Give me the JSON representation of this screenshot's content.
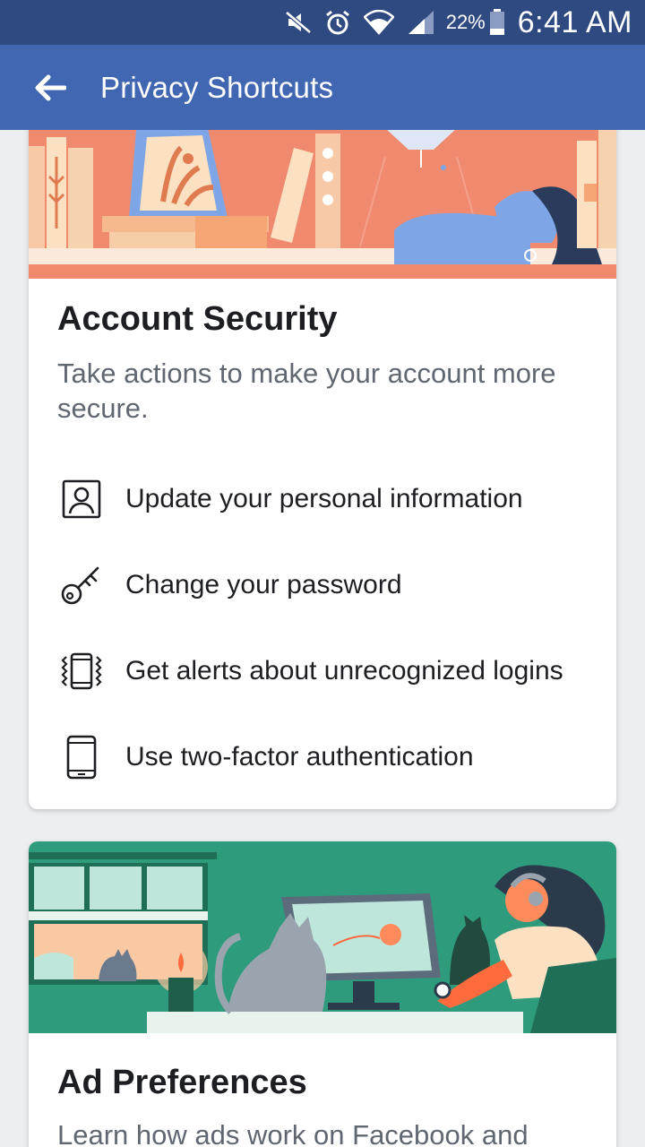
{
  "status_bar": {
    "battery_percent": "22%",
    "time": "6:41 AM",
    "icons": [
      "mute-icon",
      "alarm-icon",
      "wifi-icon",
      "signal-icon",
      "battery-icon"
    ]
  },
  "app_bar": {
    "back_icon": "back-arrow-icon",
    "title": "Privacy Shortcuts"
  },
  "account_security": {
    "title": "Account Security",
    "description": "Take actions to make your account more secure.",
    "items": [
      {
        "icon": "person-icon",
        "label": "Update your personal information"
      },
      {
        "icon": "key-icon",
        "label": "Change your password"
      },
      {
        "icon": "vibrating-phone-icon",
        "label": "Get alerts about unrecognized logins"
      },
      {
        "icon": "phone-icon",
        "label": "Use two-factor authentication"
      }
    ]
  },
  "ad_preferences": {
    "title": "Ad Preferences",
    "description": "Learn how ads work on Facebook and"
  },
  "colors": {
    "status_bar": "#2e4a80",
    "app_bar": "#4267b2",
    "banner_security": "#f08a6e",
    "banner_ads": "#2f9b7d"
  }
}
